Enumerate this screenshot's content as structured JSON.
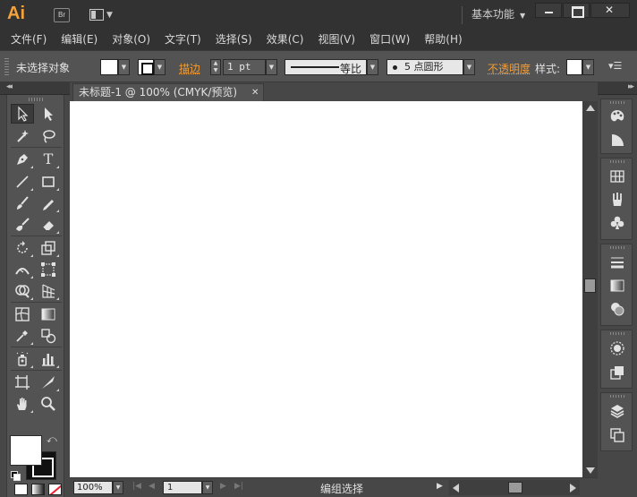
{
  "app": {
    "logo": "Ai",
    "bridge_label": "Br",
    "workspace_label": "基本功能"
  },
  "menu": [
    "文件(F)",
    "编辑(E)",
    "对象(O)",
    "文字(T)",
    "选择(S)",
    "效果(C)",
    "视图(V)",
    "窗口(W)",
    "帮助(H)"
  ],
  "control": {
    "selection_status": "未选择对象",
    "stroke_label": "描边",
    "stroke_weight": "1 pt",
    "profile_label": "等比",
    "brush_label": "5 点圆形",
    "opacity_label": "不透明度",
    "style_label": "样式:"
  },
  "document": {
    "tab_title": "未标题-1 @ 100% (CMYK/预览)"
  },
  "status": {
    "zoom": "100%",
    "page": "1",
    "text": "编组选择"
  },
  "colors": {
    "accent": "#f39c32",
    "ui_dark": "#323232",
    "ui_mid": "#535353",
    "artboard": "#ffffff"
  },
  "tools": [
    "selection-tool",
    "direct-selection-tool",
    "magic-wand-tool",
    "lasso-tool",
    "pen-tool",
    "type-tool",
    "line-segment-tool",
    "rectangle-tool",
    "paintbrush-tool",
    "pencil-tool",
    "blob-brush-tool",
    "eraser-tool",
    "rotate-tool",
    "scale-tool",
    "width-tool",
    "free-transform-tool",
    "shape-builder-tool",
    "perspective-grid-tool",
    "mesh-tool",
    "gradient-tool",
    "eyedropper-tool",
    "blend-tool",
    "symbol-sprayer-tool",
    "column-graph-tool",
    "artboard-tool",
    "slice-tool",
    "hand-tool",
    "zoom-tool"
  ],
  "right_panels": [
    "color-panel",
    "color-guide-panel",
    "swatches-panel",
    "brushes-panel",
    "symbols-panel",
    "stroke-panel",
    "gradient-panel",
    "transparency-panel",
    "appearance-panel",
    "graphic-styles-panel",
    "layers-panel",
    "artboards-panel"
  ]
}
